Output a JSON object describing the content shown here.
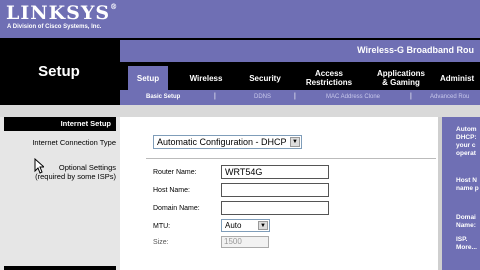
{
  "header": {
    "logo": "LINKSYS",
    "logo_mark": "®",
    "tagline": "A Division of Cisco Systems, Inc.",
    "section_title": "Setup",
    "product_name": "Wireless-G Broadband Rou"
  },
  "tabs": [
    {
      "label": "Setup",
      "active": true
    },
    {
      "label": "Wireless"
    },
    {
      "label": "Security"
    },
    {
      "label": "Access\nRestrictions"
    },
    {
      "label": "Applications\n& Gaming"
    },
    {
      "label": "Administ"
    }
  ],
  "subnav": [
    {
      "label": "Basic Setup",
      "active": true
    },
    {
      "label": "DDNS"
    },
    {
      "label": "MAC Address Clone"
    },
    {
      "label": "Advanced Rou"
    }
  ],
  "subnav_separator": "|",
  "left": {
    "section_title": "Internet Setup",
    "connection_type_label": "Internet Connection Type",
    "optional_settings_label": "Optional Settings",
    "optional_settings_note": "(required by some ISPs)"
  },
  "form": {
    "connection_type": "Automatic Configuration - DHCP",
    "router_name_label": "Router Name:",
    "router_name_value": "WRT54G",
    "host_name_label": "Host Name:",
    "host_name_value": "",
    "domain_name_label": "Domain Name:",
    "domain_name_value": "",
    "mtu_label": "MTU:",
    "mtu_value": "Auto",
    "size_label": "Size:",
    "size_value": "1500"
  },
  "help": {
    "line1": "Autom",
    "line2": "DHCP:",
    "line3": "your c",
    "line4": "operat",
    "line5": "Host N",
    "line6": "name p",
    "line7": "Domai",
    "line8": "Name:",
    "line9": "ISP.",
    "line10": "More..."
  },
  "colors": {
    "brand_purple": "#6f6fb4",
    "header_black": "#000000",
    "sidebar_gray": "#e6e6e6"
  },
  "icons": {
    "dropdown": "chevron-down-icon",
    "cursor": "mouse-pointer-icon"
  }
}
